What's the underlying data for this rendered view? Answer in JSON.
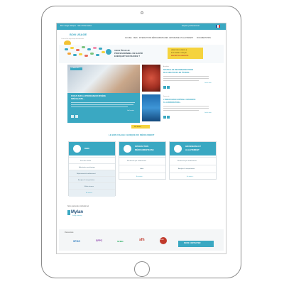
{
  "topbar": {
    "left": "Bon usage clinique · Site d'information",
    "right": "Espace professionnel"
  },
  "logo": {
    "brand": "BON USAGE",
    "tagline": "Le site du bon usage clinique du médicament"
  },
  "nav": [
    "ACCUEIL",
    "REIN",
    "INTERACTIONS MÉDICAMENTEUSES",
    "GROSSESSE ET ALLAITEMENT",
    "DOCUMENTATION"
  ],
  "hero": {
    "title_line1": "VOUS ÊTES UN",
    "title_line2": "PROFESSIONNEL DE SANTÉ",
    "title_line3": "EXERÇANT EN FRANCE ?",
    "cta_line1": "VENEZ DÉCOUVRIR LE",
    "cta_line2": "BON USAGE CLINIQUE",
    "cta_line3": "INSCRIPTION GRATUITE"
  },
  "feature": {
    "date": "11 Mars 2019",
    "title_line1": "FOCUS SUR LE PROFESSEUR RIVIÈRE",
    "title_line2": "SPÉCIALISTE...",
    "more": "Lire la suite"
  },
  "news": [
    {
      "tag": "Actualités",
      "title_line1": "NOUVELLES RECOMMANDATIONS",
      "title_line2": "DE L'EMA POUR LES ÉTUDES...",
      "more": "Lire la suite"
    },
    {
      "tag": "Focus rein",
      "title_line1": "L'INSUFFISANCE RÉNALE INTERDITE",
      "title_line2": "À LA RÉPARATION...",
      "more": "Lire la suite"
    }
  ],
  "see_all": "Voir toutes",
  "section_title": "LE BON USAGE CLINIQUE DU MÉDICAMENT",
  "cards": [
    {
      "title_line1": "REIN",
      "title_line2": "",
      "items": [
        "Fonction rénale",
        "Adaptation posologique",
        "Néphrotoxicité médicament",
        "Analyse & interprétation",
        "Effets rénaux"
      ],
      "more": "En savoir +"
    },
    {
      "title_line1": "INTERACTION",
      "title_line2": "MÉDICAMENTEUSE",
      "items": [
        "Recherche par médicament",
        "Index"
      ],
      "more": "En savoir +"
    },
    {
      "title_line1": "GROSSESSE ET",
      "title_line2": "ALLAITEMENT",
      "items": [
        "Recherche par médicament",
        "Analyse & interprétation"
      ],
      "more": "En savoir +"
    }
  ],
  "partner": {
    "heading": "Notre partenaire institutionnel",
    "name": "Mylan",
    "sub": "Seeing is believing"
  },
  "partnerships": {
    "heading": "Partenariats",
    "logos": [
      "SFGG",
      "SFPC",
      "SFMG",
      "sfh",
      "ANSM"
    ]
  },
  "contact": "NOUS CONTACTER",
  "colors": {
    "primary": "#3aa8c2",
    "accent": "#f5d33e",
    "text": "#4a4a4a"
  }
}
